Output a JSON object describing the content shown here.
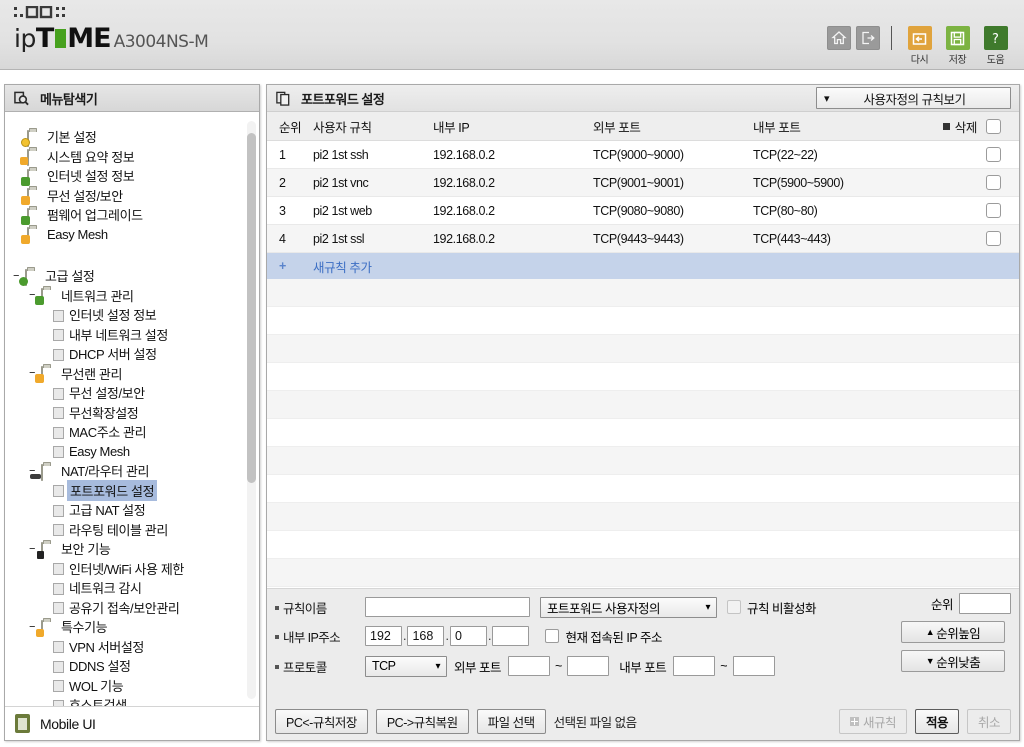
{
  "header": {
    "brand_ip": "ip",
    "brand_t": "T",
    "brand_me": "ME",
    "model": "A3004NS-M",
    "icons": [
      {
        "name": "home-icon",
        "label": ""
      },
      {
        "name": "logout-icon",
        "label": ""
      }
    ],
    "labeled_icons": [
      {
        "name": "restart-icon",
        "label": "다시",
        "color": "#e8a33d"
      },
      {
        "name": "save-icon",
        "label": "저장",
        "color": "#7cb342"
      },
      {
        "name": "help-icon",
        "label": "도움",
        "color": "#4a7c2f"
      }
    ]
  },
  "sidebar": {
    "title": "메뉴탐색기",
    "mobile_ui_label": "Mobile UI",
    "groups": [
      {
        "label": "기본 설정",
        "expander": "",
        "icon": "folder-gear-icon",
        "items": [
          {
            "label": "시스템 요약 정보",
            "icon": "chart-icon"
          },
          {
            "label": "인터넷 설정 정보",
            "icon": "monitor-icon"
          },
          {
            "label": "무선 설정/보안",
            "icon": "wifi-icon"
          },
          {
            "label": "펌웨어 업그레이드",
            "icon": "upload-icon"
          },
          {
            "label": "Easy Mesh",
            "icon": "wifi-icon"
          }
        ]
      },
      {
        "label": "고급 설정",
        "expander": "–",
        "icon": "folder-gear-icon",
        "subgroups": [
          {
            "label": "네트워크 관리",
            "expander": "–",
            "icon": "folder-network-icon",
            "items": [
              {
                "label": "인터넷 설정 정보"
              },
              {
                "label": "내부 네트워크 설정"
              },
              {
                "label": "DHCP 서버 설정"
              }
            ]
          },
          {
            "label": "무선랜 관리",
            "expander": "–",
            "icon": "folder-wifi-icon",
            "items": [
              {
                "label": "무선 설정/보안"
              },
              {
                "label": "무선확장설정"
              },
              {
                "label": "MAC주소 관리"
              },
              {
                "label": "Easy Mesh"
              }
            ]
          },
          {
            "label": "NAT/라우터 관리",
            "expander": "–",
            "icon": "folder-router-icon",
            "items": [
              {
                "label": "포트포워드 설정",
                "selected": true
              },
              {
                "label": "고급 NAT 설정"
              },
              {
                "label": "라우팅 테이블 관리"
              }
            ]
          },
          {
            "label": "보안 기능",
            "expander": "–",
            "icon": "folder-lock-icon",
            "items": [
              {
                "label": "인터넷/WiFi 사용 제한"
              },
              {
                "label": "네트워크 감시"
              },
              {
                "label": "공유기 접속/보안관리"
              }
            ]
          },
          {
            "label": "특수기능",
            "expander": "–",
            "icon": "folder-special-icon",
            "items": [
              {
                "label": "VPN 서버설정"
              },
              {
                "label": "DDNS 설정"
              },
              {
                "label": "WOL 기능"
              },
              {
                "label": "호스트검색"
              }
            ]
          }
        ]
      }
    ]
  },
  "main": {
    "title": "포트포워드 설정",
    "rule_view_select": "사용자정의 규칙보기",
    "table": {
      "columns": [
        "순위",
        "사용자 규칙",
        "내부 IP",
        "외부 포트",
        "내부 포트",
        "삭제"
      ],
      "rows": [
        {
          "no": "1",
          "name": "pi2 1st ssh",
          "ip": "192.168.0.2",
          "ext": "TCP(9000~9000)",
          "int": "TCP(22~22)"
        },
        {
          "no": "2",
          "name": "pi2 1st vnc",
          "ip": "192.168.0.2",
          "ext": "TCP(9001~9001)",
          "int": "TCP(5900~5900)"
        },
        {
          "no": "3",
          "name": "pi2 1st web",
          "ip": "192.168.0.2",
          "ext": "TCP(9080~9080)",
          "int": "TCP(80~80)"
        },
        {
          "no": "4",
          "name": "pi2 1st ssl",
          "ip": "192.168.0.2",
          "ext": "TCP(9443~9443)",
          "int": "TCP(443~443)"
        }
      ],
      "add_row_label": "새규칙 추가",
      "add_row_plus": "+"
    },
    "form": {
      "rule_name_label": "규칙이름",
      "rule_name_value": "",
      "preset_select": "포트포워드 사용자정의",
      "disable_rule_label": "규칙 비활성화",
      "internal_ip_label": "내부 IP주소",
      "ip_octets": [
        "192",
        "168",
        "0",
        ""
      ],
      "current_ip_label": "현재 접속된 IP 주소",
      "protocol_label": "프로토콜",
      "protocol_value": "TCP",
      "ext_port_label": "외부 포트",
      "ext_port_from": "",
      "ext_port_to": "",
      "int_port_label": "내부 포트",
      "int_port_from": "",
      "int_port_to": "",
      "tilde": "~",
      "order_label": "순위",
      "order_value": "",
      "order_up": "순위높임",
      "order_down": "순위낮춤"
    },
    "buttons": {
      "save_to_pc": "PC<-규칙저장",
      "restore_from_pc": "PC->규칙복원",
      "file_select": "파일 선택",
      "file_status": "선택된 파일 없음",
      "new_rule": "새규칙",
      "apply": "적용",
      "cancel": "취소"
    }
  }
}
